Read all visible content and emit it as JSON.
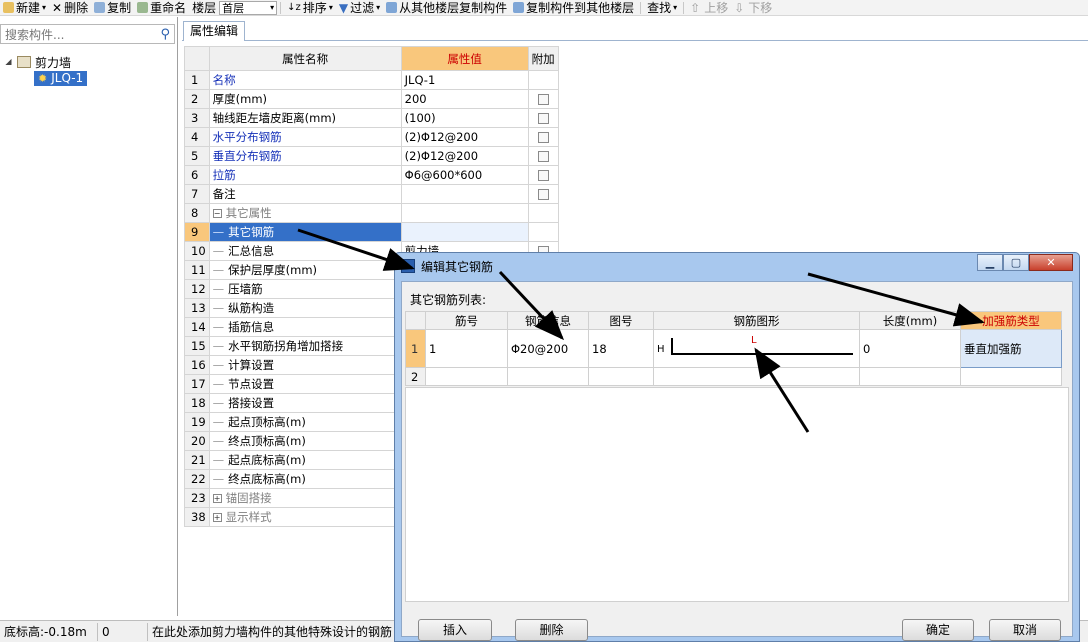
{
  "toolbar": {
    "new": "新建",
    "delete": "删除",
    "copy": "复制",
    "rename": "重命名",
    "floor_label": "楼层",
    "floor_value": "首层",
    "sort": "排序",
    "filter": "过滤",
    "copy_from_other_floor": "从其他楼层复制构件",
    "copy_to_other_floor": "复制构件到其他楼层",
    "find": "查找",
    "move_up": "上移",
    "move_down": "下移"
  },
  "left_panel": {
    "search_placeholder": "搜索构件...",
    "tree_root": "剪力墙",
    "tree_child": "JLQ-1"
  },
  "editor": {
    "tab": "属性编辑",
    "headers": {
      "name": "属性名称",
      "value": "属性值",
      "extra": "附加"
    },
    "rows": [
      {
        "num": "1",
        "name": "名称",
        "value": "JLQ-1"
      },
      {
        "num": "2",
        "name": "厚度(mm)",
        "value": "200"
      },
      {
        "num": "3",
        "name": "轴线距左墙皮距离(mm)",
        "value": "(100)"
      },
      {
        "num": "4",
        "name": "水平分布钢筋",
        "value": "(2)Φ12@200"
      },
      {
        "num": "5",
        "name": "垂直分布钢筋",
        "value": "(2)Φ12@200"
      },
      {
        "num": "6",
        "name": "拉筋",
        "value": "Φ6@600*600"
      },
      {
        "num": "7",
        "name": "备注",
        "value": ""
      },
      {
        "num": "8",
        "name": "其它属性",
        "value": ""
      },
      {
        "num": "9",
        "name": "其它钢筋",
        "value": ""
      },
      {
        "num": "10",
        "name": "汇总信息",
        "value": "剪力墙"
      },
      {
        "num": "11",
        "name": "保护层厚度(mm)",
        "value": ""
      },
      {
        "num": "12",
        "name": "压墙筋",
        "value": ""
      },
      {
        "num": "13",
        "name": "纵筋构造",
        "value": ""
      },
      {
        "num": "14",
        "name": "插筋信息",
        "value": ""
      },
      {
        "num": "15",
        "name": "水平钢筋拐角增加搭接",
        "value": ""
      },
      {
        "num": "16",
        "name": "计算设置",
        "value": ""
      },
      {
        "num": "17",
        "name": "节点设置",
        "value": ""
      },
      {
        "num": "18",
        "name": "搭接设置",
        "value": ""
      },
      {
        "num": "19",
        "name": "起点顶标高(m)",
        "value": ""
      },
      {
        "num": "20",
        "name": "终点顶标高(m)",
        "value": ""
      },
      {
        "num": "21",
        "name": "起点底标高(m)",
        "value": ""
      },
      {
        "num": "22",
        "name": "终点底标高(m)",
        "value": ""
      },
      {
        "num": "23",
        "name": "锚固搭接",
        "value": ""
      },
      {
        "num": "38",
        "name": "显示样式",
        "value": ""
      }
    ]
  },
  "status": {
    "bottom_elev": "底标高:-0.18m",
    "zero": "0",
    "hint": "在此处添加剪力墙构件的其他特殊设计的钢筋"
  },
  "dialog": {
    "title": "编辑其它钢筋",
    "list_label": "其它钢筋列表:",
    "headers": [
      "筋号",
      "钢筋信息",
      "图号",
      "钢筋图形",
      "长度(mm)",
      "加强筋类型"
    ],
    "rows": [
      {
        "num": "1",
        "bar_no": "1",
        "bar_info": "Φ20@200",
        "fig_no": "18",
        "shape_h": "H",
        "shape_l": "L",
        "length": "0",
        "type": "垂直加强筋"
      },
      {
        "num": "2",
        "bar_no": "",
        "bar_info": "",
        "fig_no": "",
        "shape_h": "",
        "shape_l": "",
        "length": "",
        "type": ""
      }
    ],
    "buttons": {
      "insert": "插入",
      "delete": "删除",
      "ok": "确定",
      "cancel": "取消"
    }
  },
  "colors": {
    "accent": "#f9c77c",
    "selection": "#3470c8",
    "link_blue": "#1530b8"
  }
}
